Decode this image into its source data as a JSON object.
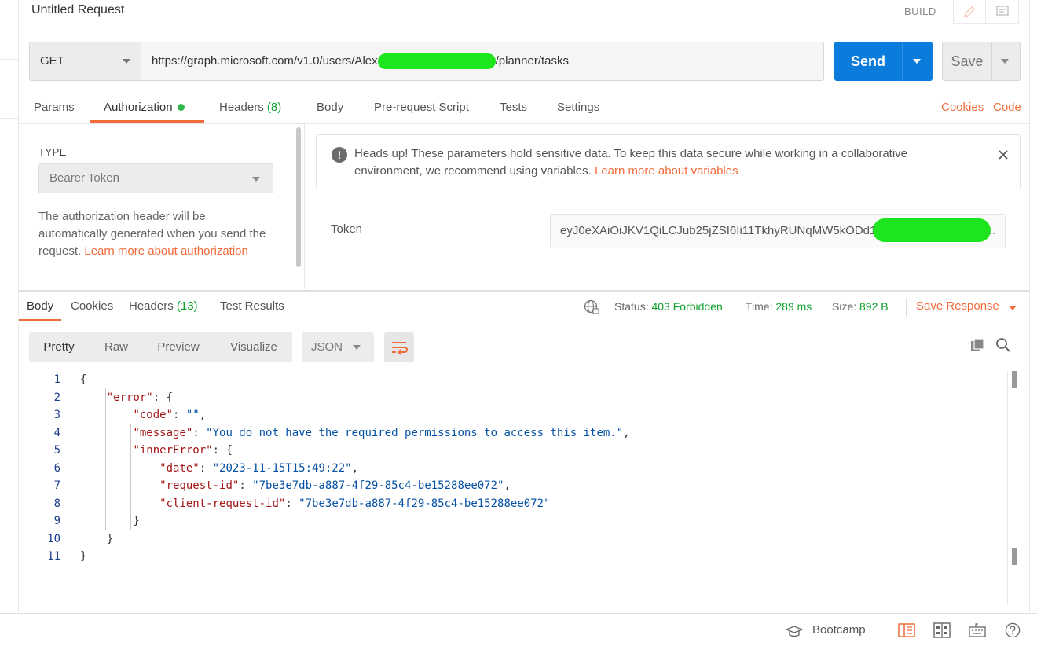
{
  "header": {
    "title": "Untitled Request",
    "mode_label": "BUILD",
    "edit_icon": "pencil-icon",
    "comment_icon": "comment-icon"
  },
  "request": {
    "method": "GET",
    "url_prefix": "https://graph.microsoft.com/v1.0/users/Alex",
    "url_suffix": "/planner/tasks",
    "send_label": "Send",
    "save_label": "Save"
  },
  "request_tabs": {
    "params": "Params",
    "authorization": "Authorization",
    "headers": "Headers",
    "headers_count": "(8)",
    "body": "Body",
    "pre_request": "Pre-request Script",
    "tests": "Tests",
    "settings": "Settings",
    "cookies": "Cookies",
    "code": "Code"
  },
  "auth": {
    "type_heading": "TYPE",
    "type_value": "Bearer Token",
    "description": "The authorization header will be automatically generated when you send the request.",
    "learn_more": "Learn more about authorization",
    "notice": "Heads up! These parameters hold sensitive data. To keep this data secure while working in a collaborative environment, we recommend using variables.",
    "notice_link": "Learn more about variables",
    "token_label": "Token",
    "token_value": "eyJ0eXAiOiJKV1QiLCJub25jZSI6Ii11TkhyRUNqMW5kODd1",
    "token_ellipsis": "..."
  },
  "response_tabs": {
    "body": "Body",
    "cookies": "Cookies",
    "headers": "Headers",
    "headers_count": "(13)",
    "test_results": "Test Results"
  },
  "response_meta": {
    "status_label": "Status:",
    "status_value": "403 Forbidden",
    "time_label": "Time:",
    "time_value": "289 ms",
    "size_label": "Size:",
    "size_value": "892 B",
    "save_response": "Save Response"
  },
  "view": {
    "pretty": "Pretty",
    "raw": "Raw",
    "preview": "Preview",
    "visualize": "Visualize",
    "format": "JSON"
  },
  "code_lines": [
    {
      "n": "1",
      "html": "{"
    },
    {
      "n": "2",
      "html": "    <span class='k'>\"error\"</span>: {"
    },
    {
      "n": "3",
      "html": "        <span class='k'>\"code\"</span>: <span class='s'>\"\"</span>,"
    },
    {
      "n": "4",
      "html": "        <span class='k'>\"message\"</span>: <span class='s'>\"You do not have the required permissions to access this item.\"</span>,"
    },
    {
      "n": "5",
      "html": "        <span class='k'>\"innerError\"</span>: {"
    },
    {
      "n": "6",
      "html": "            <span class='k'>\"date\"</span>: <span class='s'>\"2023-11-15T15:49:22\"</span>,"
    },
    {
      "n": "7",
      "html": "            <span class='k'>\"request-id\"</span>: <span class='s'>\"7be3e7db-a887-4f29-85c4-be15288ee072\"</span>,"
    },
    {
      "n": "8",
      "html": "            <span class='k'>\"client-request-id\"</span>: <span class='s'>\"7be3e7db-a887-4f29-85c4-be15288ee072\"</span>"
    },
    {
      "n": "9",
      "html": "        }"
    },
    {
      "n": "10",
      "html": "    }"
    },
    {
      "n": "11",
      "html": "}"
    }
  ],
  "statusbar": {
    "bootcamp": "Bootcamp"
  },
  "colors": {
    "accent": "#f26b3a",
    "send": "#0b7bdc",
    "success": "#0ca02c"
  }
}
